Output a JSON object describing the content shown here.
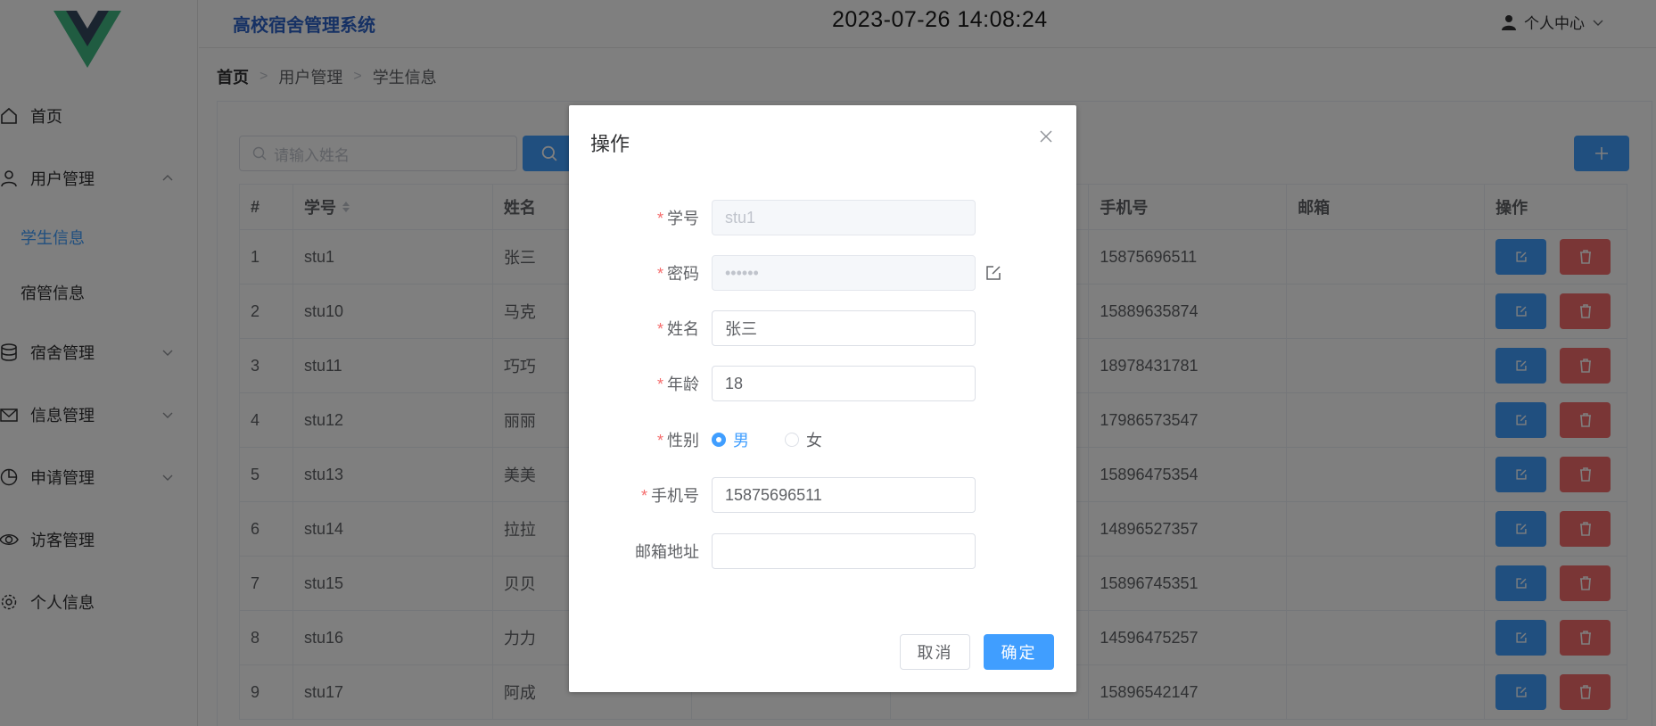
{
  "header": {
    "system_title": "高校宿舍管理系统",
    "clock": "2023-07-26 14:08:24",
    "user_center": "个人中心"
  },
  "sidebar": {
    "items": [
      {
        "label": "首页",
        "icon": "home-icon"
      },
      {
        "label": "用户管理",
        "icon": "user-icon",
        "expanded": true
      },
      {
        "label": "学生信息",
        "sub": true,
        "active": true
      },
      {
        "label": "宿管信息",
        "sub": true
      },
      {
        "label": "宿舍管理",
        "icon": "database-icon"
      },
      {
        "label": "信息管理",
        "icon": "message-icon"
      },
      {
        "label": "申请管理",
        "icon": "pie-chart-icon"
      },
      {
        "label": "访客管理",
        "icon": "eye-icon"
      },
      {
        "label": "个人信息",
        "icon": "gear-icon"
      }
    ]
  },
  "breadcrumb": [
    "首页",
    "用户管理",
    "学生信息"
  ],
  "search": {
    "placeholder": "请输入姓名"
  },
  "table": {
    "headers": [
      "#",
      "学号",
      "姓名",
      "",
      "",
      "手机号",
      "邮箱",
      "操作"
    ],
    "rows": [
      {
        "idx": "1",
        "sid": "stu1",
        "name": "张三",
        "phone": "15875696511"
      },
      {
        "idx": "2",
        "sid": "stu10",
        "name": "马克",
        "phone": "15889635874"
      },
      {
        "idx": "3",
        "sid": "stu11",
        "name": "巧巧",
        "phone": "18978431781"
      },
      {
        "idx": "4",
        "sid": "stu12",
        "name": "丽丽",
        "phone": "17986573547"
      },
      {
        "idx": "5",
        "sid": "stu13",
        "name": "美美",
        "phone": "15896475354"
      },
      {
        "idx": "6",
        "sid": "stu14",
        "name": "拉拉",
        "phone": "14896527357"
      },
      {
        "idx": "7",
        "sid": "stu15",
        "name": "贝贝",
        "phone": "15896745351"
      },
      {
        "idx": "8",
        "sid": "stu16",
        "name": "力力",
        "phone": "14596475257"
      },
      {
        "idx": "9",
        "sid": "stu17",
        "name": "阿成",
        "phone": "15896542147"
      }
    ]
  },
  "dialog": {
    "title": "操作",
    "fields": {
      "sid": {
        "label": "学号",
        "value": "stu1",
        "required": true
      },
      "password": {
        "label": "密码",
        "value": "••••••",
        "required": true
      },
      "name": {
        "label": "姓名",
        "value": "张三",
        "required": true
      },
      "age": {
        "label": "年龄",
        "value": "18",
        "required": true
      },
      "gender": {
        "label": "性别",
        "required": true,
        "options": [
          "男",
          "女"
        ],
        "selected": "男"
      },
      "phone": {
        "label": "手机号",
        "value": "15875696511",
        "required": true
      },
      "email": {
        "label": "邮箱地址",
        "value": "",
        "required": false
      }
    },
    "cancel_label": "取消",
    "ok_label": "确定"
  },
  "colors": {
    "primary": "#409eff",
    "danger": "#f56c6c",
    "title": "#2c63c8",
    "vue_green": "#41b883",
    "vue_dark": "#35495e"
  }
}
